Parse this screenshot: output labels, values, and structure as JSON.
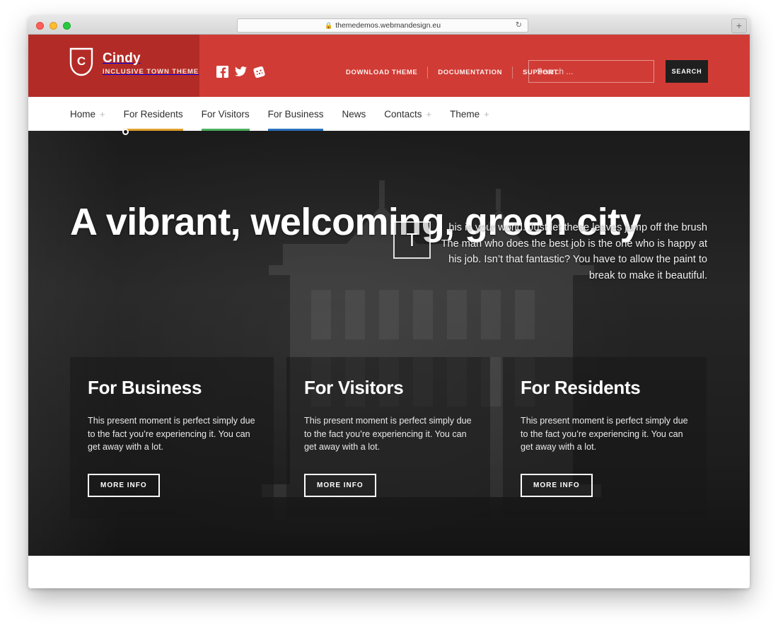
{
  "browser": {
    "url": "themedemos.webmandesign.eu",
    "lock_icon": "lock-icon",
    "reload_icon": "reload-icon",
    "newtab_label": "+",
    "traffic_lights": [
      "close",
      "minimize",
      "maximize"
    ]
  },
  "header": {
    "brand_name": "Cindy",
    "brand_tagline": "INCLUSIVE TOWN THEME",
    "logo_icon": "shield-logo-icon",
    "logo_letter": "C",
    "band_color": "#b32b26",
    "bg_color": "#d03c35",
    "social": [
      {
        "name": "facebook-icon",
        "label": "Facebook"
      },
      {
        "name": "twitter-icon",
        "label": "Twitter"
      },
      {
        "name": "dribbble-icon",
        "label": "Dribbble"
      }
    ],
    "links": [
      {
        "label": "DOWNLOAD THEME"
      },
      {
        "label": "DOCUMENTATION"
      },
      {
        "label": "SUPPORT"
      }
    ],
    "search": {
      "placeholder": "Search ...",
      "value": "",
      "button_label": "SEARCH",
      "button_color": "#1f1f1f"
    }
  },
  "main_nav": {
    "items": [
      {
        "label": "Home",
        "has_submenu": true,
        "bar_color": ""
      },
      {
        "label": "For Residents",
        "has_submenu": false,
        "bar_color": "#e0a030"
      },
      {
        "label": "For Visitors",
        "has_submenu": false,
        "bar_color": "#4caf60"
      },
      {
        "label": "For Business",
        "has_submenu": false,
        "bar_color": "#2a72bd"
      },
      {
        "label": "News",
        "has_submenu": false,
        "bar_color": ""
      },
      {
        "label": "Contacts",
        "has_submenu": true,
        "bar_color": ""
      },
      {
        "label": "Theme",
        "has_submenu": true,
        "bar_color": ""
      }
    ],
    "submenu_glyph": "+"
  },
  "hero": {
    "title": "A vibrant, welcoming, green city",
    "dropcap": "T",
    "paragraph": "his is your world. Just let these leaves jump off the brush The man who does the best job is the one who is happy at his job. Isn’t that fantastic? You have to allow the paint to break to make it beautiful.",
    "cards": [
      {
        "title": "For Business",
        "text": "This present moment is perfect simply due to the fact you’re experiencing it. You can get away with a lot.",
        "button_label": "MORE INFO"
      },
      {
        "title": "For Visitors",
        "text": "This present moment is perfect simply due to the fact you’re experiencing it. You can get away with a lot.",
        "button_label": "MORE INFO"
      },
      {
        "title": "For Residents",
        "text": "This present moment is perfect simply due to the fact you’re experiencing it. You can get away with a lot.",
        "button_label": "MORE INFO"
      }
    ]
  }
}
